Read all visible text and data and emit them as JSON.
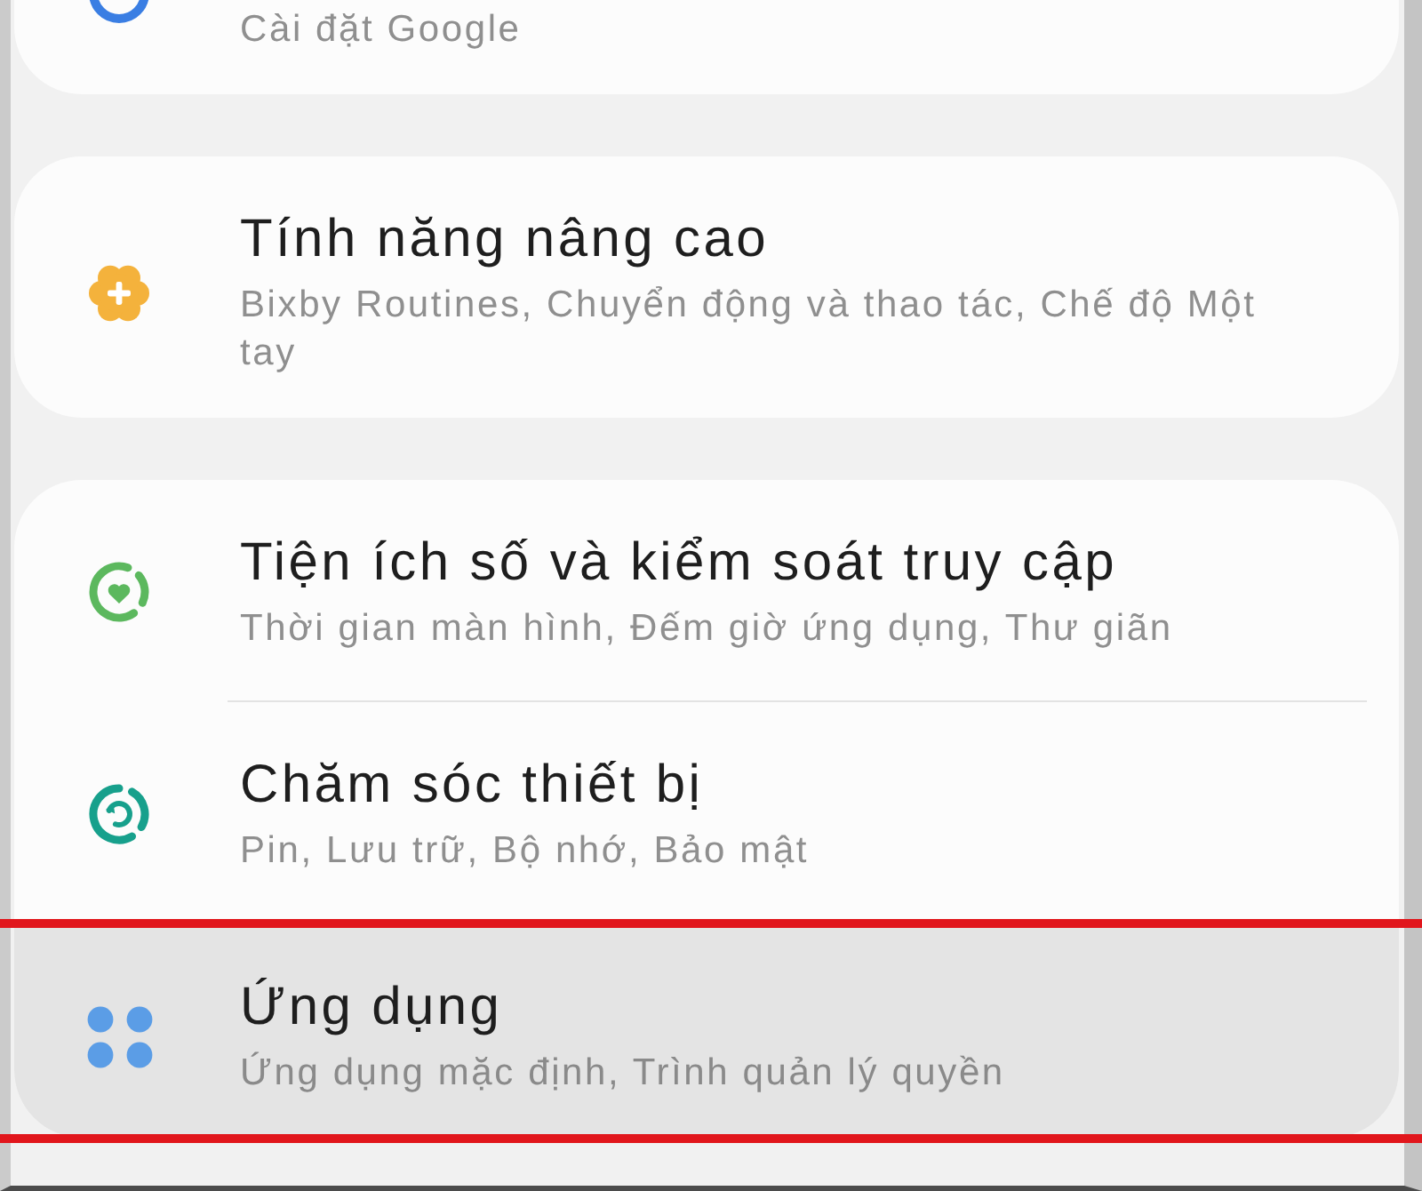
{
  "cards": [
    {
      "items": [
        {
          "subtitle": "Cài đặt Google",
          "selected": false
        }
      ]
    },
    {
      "items": [
        {
          "title": "Tính năng nâng cao",
          "subtitle": "Bixby Routines, Chuyển động và thao tác, Chế độ Một tay",
          "selected": false
        }
      ]
    },
    {
      "items": [
        {
          "title": "Tiện ích số và kiểm soát truy cập",
          "subtitle": "Thời gian màn hình, Đếm giờ ứng dụng, Thư giãn",
          "selected": false
        },
        {
          "title": "Chăm sóc thiết bị",
          "subtitle": "Pin, Lưu trữ, Bộ nhớ, Bảo mật",
          "selected": false
        },
        {
          "title": "Ứng dụng",
          "subtitle": "Ứng dụng mặc định, Trình quản lý quyền",
          "selected": true
        }
      ]
    }
  ]
}
